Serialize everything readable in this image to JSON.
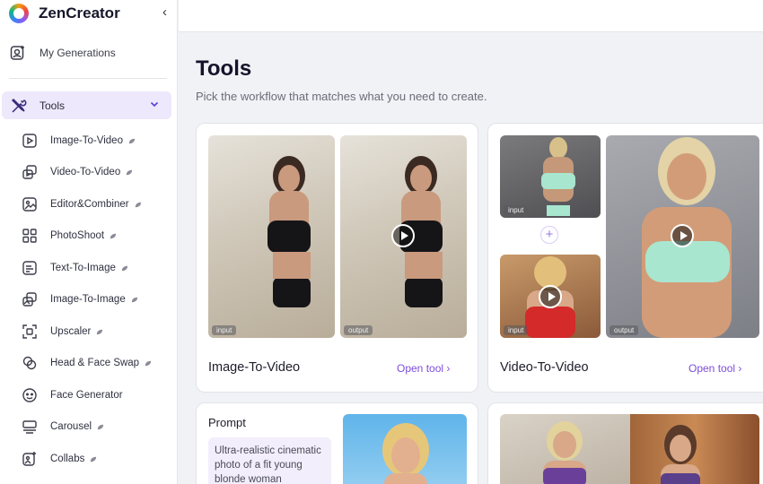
{
  "app": {
    "name": "ZenCreator",
    "collapse_glyph": "‹"
  },
  "sidebar": {
    "my_generations": "My Generations",
    "tools": "Tools",
    "items": [
      {
        "label": "Image-To-Video",
        "icon": "play-square-icon"
      },
      {
        "label": "Video-To-Video",
        "icon": "video-stack-icon"
      },
      {
        "label": "Editor&Combiner",
        "icon": "image-edit-icon"
      },
      {
        "label": "PhotoShoot",
        "icon": "grid-icon"
      },
      {
        "label": "Text-To-Image",
        "icon": "text-image-icon"
      },
      {
        "label": "Image-To-Image",
        "icon": "image-stack-icon"
      },
      {
        "label": "Upscaler",
        "icon": "upscale-icon"
      },
      {
        "label": "Head & Face Swap",
        "icon": "face-swap-icon"
      },
      {
        "label": "Face Generator",
        "icon": "face-icon"
      },
      {
        "label": "Carousel",
        "icon": "carousel-icon"
      },
      {
        "label": "Collabs",
        "icon": "collab-icon"
      }
    ]
  },
  "main": {
    "title": "Tools",
    "subtitle": "Pick the workflow that matches what you need to create.",
    "cards": [
      {
        "title": "Image-To-Video",
        "open_label": "Open tool ›",
        "input_tag": "input",
        "output_tag": "output"
      },
      {
        "title": "Video-To-Video",
        "open_label": "Open tool ›",
        "input_tag": "input",
        "output_tag": "output"
      }
    ],
    "prompt_card": {
      "label": "Prompt",
      "text": "Ultra-realistic cinematic photo of a fit young blonde woman"
    },
    "plus_glyph": "+"
  },
  "colors": {
    "accent": "#7c4ddb",
    "active_bg": "#ede8fb"
  }
}
